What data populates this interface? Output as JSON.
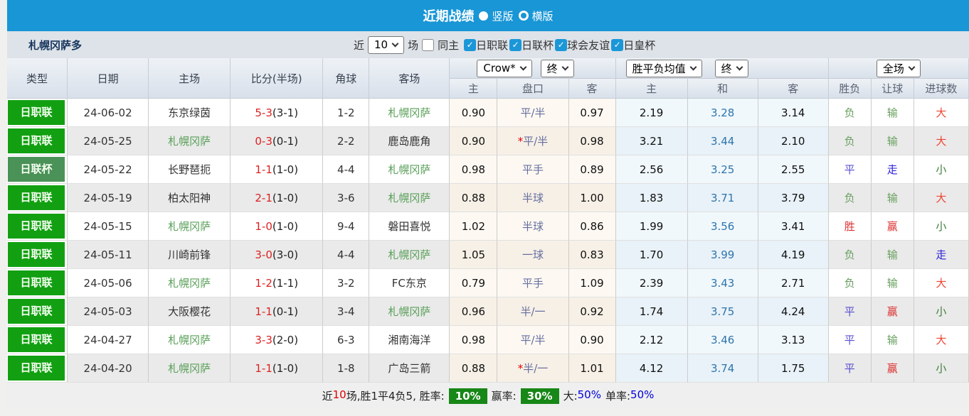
{
  "colors": {
    "accent_blue": "#1996D6",
    "league_green": "#12A012",
    "cup_green": "#4A9257",
    "team_highlight_green": "#5AA05A",
    "score_red": "#DD2222",
    "handicap_purple": "#666FA0",
    "avg_draw_blue": "#2F74AB",
    "win_red": "#DC3232",
    "draw_blue": "#5A50D0",
    "loss_green": "#69A05F",
    "go_blue": "#2A1FD8",
    "big_red": "#EF4433",
    "small_green": "#3F7F3A",
    "badge_green": "#178717",
    "rate_blue": "#0000DD"
  },
  "title_bar": {
    "title": "近期战绩",
    "option_vertical": "竖版",
    "option_horizontal": "横版"
  },
  "filter_bar": {
    "team_name": "札幌冈萨多",
    "recent_label": "近",
    "recent_value": "10",
    "matches_label": "场",
    "same_home_label": "同主",
    "same_home_checked": false,
    "league_filters": [
      {
        "label": "日职联",
        "checked": true
      },
      {
        "label": "日联杯",
        "checked": true
      },
      {
        "label": "球会友谊",
        "checked": true
      },
      {
        "label": "日皇杯",
        "checked": true
      }
    ]
  },
  "table": {
    "main_headers": [
      "类型",
      "日期",
      "主场",
      "比分(半场)",
      "角球",
      "客场"
    ],
    "selects": {
      "odds_company": "Crow*",
      "odds_stage": "终",
      "avg_type": "胜平负均值",
      "avg_stage": "终",
      "scope": "全场"
    },
    "sub_headers": [
      "主",
      "盘口",
      "客",
      "主",
      "和",
      "客",
      "胜负",
      "让球",
      "进球数"
    ],
    "rows": [
      {
        "type": "日职联",
        "type_kind": "league",
        "date": "24-06-02",
        "home": "东京绿茵",
        "home_hl": false,
        "score": "5-3",
        "half": "(3-1)",
        "corner": "1-2",
        "away": "札幌冈萨",
        "away_hl": true,
        "h_home": "0.90",
        "handicap": "平/半",
        "star": false,
        "h_away": "0.97",
        "avg_home": "2.19",
        "avg_draw": "3.28",
        "avg_away": "3.14",
        "result": "负",
        "result_c": "loss",
        "spread": "输",
        "spread_c": "loss",
        "goals": "大",
        "goals_c": "big"
      },
      {
        "type": "日职联",
        "type_kind": "league",
        "date": "24-05-25",
        "home": "札幌冈萨",
        "home_hl": true,
        "score": "0-3",
        "half": "(0-1)",
        "corner": "2-2",
        "away": "鹿岛鹿角",
        "away_hl": false,
        "h_home": "0.90",
        "handicap": "平/半",
        "star": true,
        "h_away": "0.98",
        "avg_home": "3.21",
        "avg_draw": "3.44",
        "avg_away": "2.10",
        "result": "负",
        "result_c": "loss",
        "spread": "输",
        "spread_c": "loss",
        "goals": "大",
        "goals_c": "big"
      },
      {
        "type": "日联杯",
        "type_kind": "cup",
        "date": "24-05-22",
        "home": "长野琶扼",
        "home_hl": false,
        "score": "1-1",
        "half": "(1-0)",
        "corner": "4-4",
        "away": "札幌冈萨",
        "away_hl": true,
        "h_home": "0.98",
        "handicap": "平手",
        "star": false,
        "h_away": "0.89",
        "avg_home": "2.56",
        "avg_draw": "3.25",
        "avg_away": "2.55",
        "result": "平",
        "result_c": "draw",
        "spread": "走",
        "spread_c": "go",
        "goals": "小",
        "goals_c": "small"
      },
      {
        "type": "日职联",
        "type_kind": "league",
        "date": "24-05-19",
        "home": "柏太阳神",
        "home_hl": false,
        "score": "2-1",
        "half": "(1-0)",
        "corner": "3-6",
        "away": "札幌冈萨",
        "away_hl": true,
        "h_home": "0.88",
        "handicap": "半球",
        "star": false,
        "h_away": "1.00",
        "avg_home": "1.83",
        "avg_draw": "3.71",
        "avg_away": "3.79",
        "result": "负",
        "result_c": "loss",
        "spread": "输",
        "spread_c": "loss",
        "goals": "大",
        "goals_c": "big"
      },
      {
        "type": "日职联",
        "type_kind": "league",
        "date": "24-05-15",
        "home": "札幌冈萨",
        "home_hl": true,
        "score": "1-0",
        "half": "(1-0)",
        "corner": "9-4",
        "away": "磐田喜悦",
        "away_hl": false,
        "h_home": "1.02",
        "handicap": "半球",
        "star": false,
        "h_away": "0.86",
        "avg_home": "1.99",
        "avg_draw": "3.56",
        "avg_away": "3.41",
        "result": "胜",
        "result_c": "win",
        "spread": "赢",
        "spread_c": "win",
        "goals": "小",
        "goals_c": "small"
      },
      {
        "type": "日职联",
        "type_kind": "league",
        "date": "24-05-11",
        "home": "川崎前锋",
        "home_hl": false,
        "score": "3-0",
        "half": "(3-0)",
        "corner": "4-4",
        "away": "札幌冈萨",
        "away_hl": true,
        "h_home": "1.05",
        "handicap": "一球",
        "star": false,
        "h_away": "0.83",
        "avg_home": "1.70",
        "avg_draw": "3.99",
        "avg_away": "4.19",
        "result": "负",
        "result_c": "loss",
        "spread": "输",
        "spread_c": "loss",
        "goals": "走",
        "goals_c": "go"
      },
      {
        "type": "日职联",
        "type_kind": "league",
        "date": "24-05-06",
        "home": "札幌冈萨",
        "home_hl": true,
        "score": "1-2",
        "half": "(1-1)",
        "corner": "3-2",
        "away": "FC东京",
        "away_hl": false,
        "h_home": "0.79",
        "handicap": "平手",
        "star": false,
        "h_away": "1.09",
        "avg_home": "2.39",
        "avg_draw": "3.43",
        "avg_away": "2.71",
        "result": "负",
        "result_c": "loss",
        "spread": "输",
        "spread_c": "loss",
        "goals": "大",
        "goals_c": "big"
      },
      {
        "type": "日职联",
        "type_kind": "league",
        "date": "24-05-03",
        "home": "大阪樱花",
        "home_hl": false,
        "score": "1-1",
        "half": "(0-1)",
        "corner": "3-4",
        "away": "札幌冈萨",
        "away_hl": true,
        "h_home": "0.96",
        "handicap": "半/一",
        "star": false,
        "h_away": "0.92",
        "avg_home": "1.74",
        "avg_draw": "3.75",
        "avg_away": "4.24",
        "result": "平",
        "result_c": "draw",
        "spread": "赢",
        "spread_c": "win",
        "goals": "小",
        "goals_c": "small"
      },
      {
        "type": "日职联",
        "type_kind": "league",
        "date": "24-04-27",
        "home": "札幌冈萨",
        "home_hl": true,
        "score": "3-3",
        "half": "(2-0)",
        "corner": "6-3",
        "away": "湘南海洋",
        "away_hl": false,
        "h_home": "0.98",
        "handicap": "平/半",
        "star": false,
        "h_away": "0.90",
        "avg_home": "2.12",
        "avg_draw": "3.46",
        "avg_away": "3.13",
        "result": "平",
        "result_c": "draw",
        "spread": "输",
        "spread_c": "loss",
        "goals": "大",
        "goals_c": "big"
      },
      {
        "type": "日职联",
        "type_kind": "league",
        "date": "24-04-20",
        "home": "札幌冈萨",
        "home_hl": true,
        "score": "1-1",
        "half": "(1-0)",
        "corner": "1-8",
        "away": "广岛三箭",
        "away_hl": false,
        "h_home": "0.88",
        "handicap": "半/一",
        "star": true,
        "h_away": "1.01",
        "avg_home": "4.12",
        "avg_draw": "3.74",
        "avg_away": "1.75",
        "result": "平",
        "result_c": "draw",
        "spread": "赢",
        "spread_c": "win",
        "goals": "小",
        "goals_c": "small"
      }
    ]
  },
  "footer": {
    "recent_label": "近",
    "recent_count": "10",
    "summary": "场,胜1平4负5, 胜率:",
    "win_rate": "10%",
    "profit_label": "赢率:",
    "profit_rate": "30%",
    "big_label": "大:",
    "big_rate": "50%",
    "single_label": "单率:",
    "single_rate": "50%"
  }
}
